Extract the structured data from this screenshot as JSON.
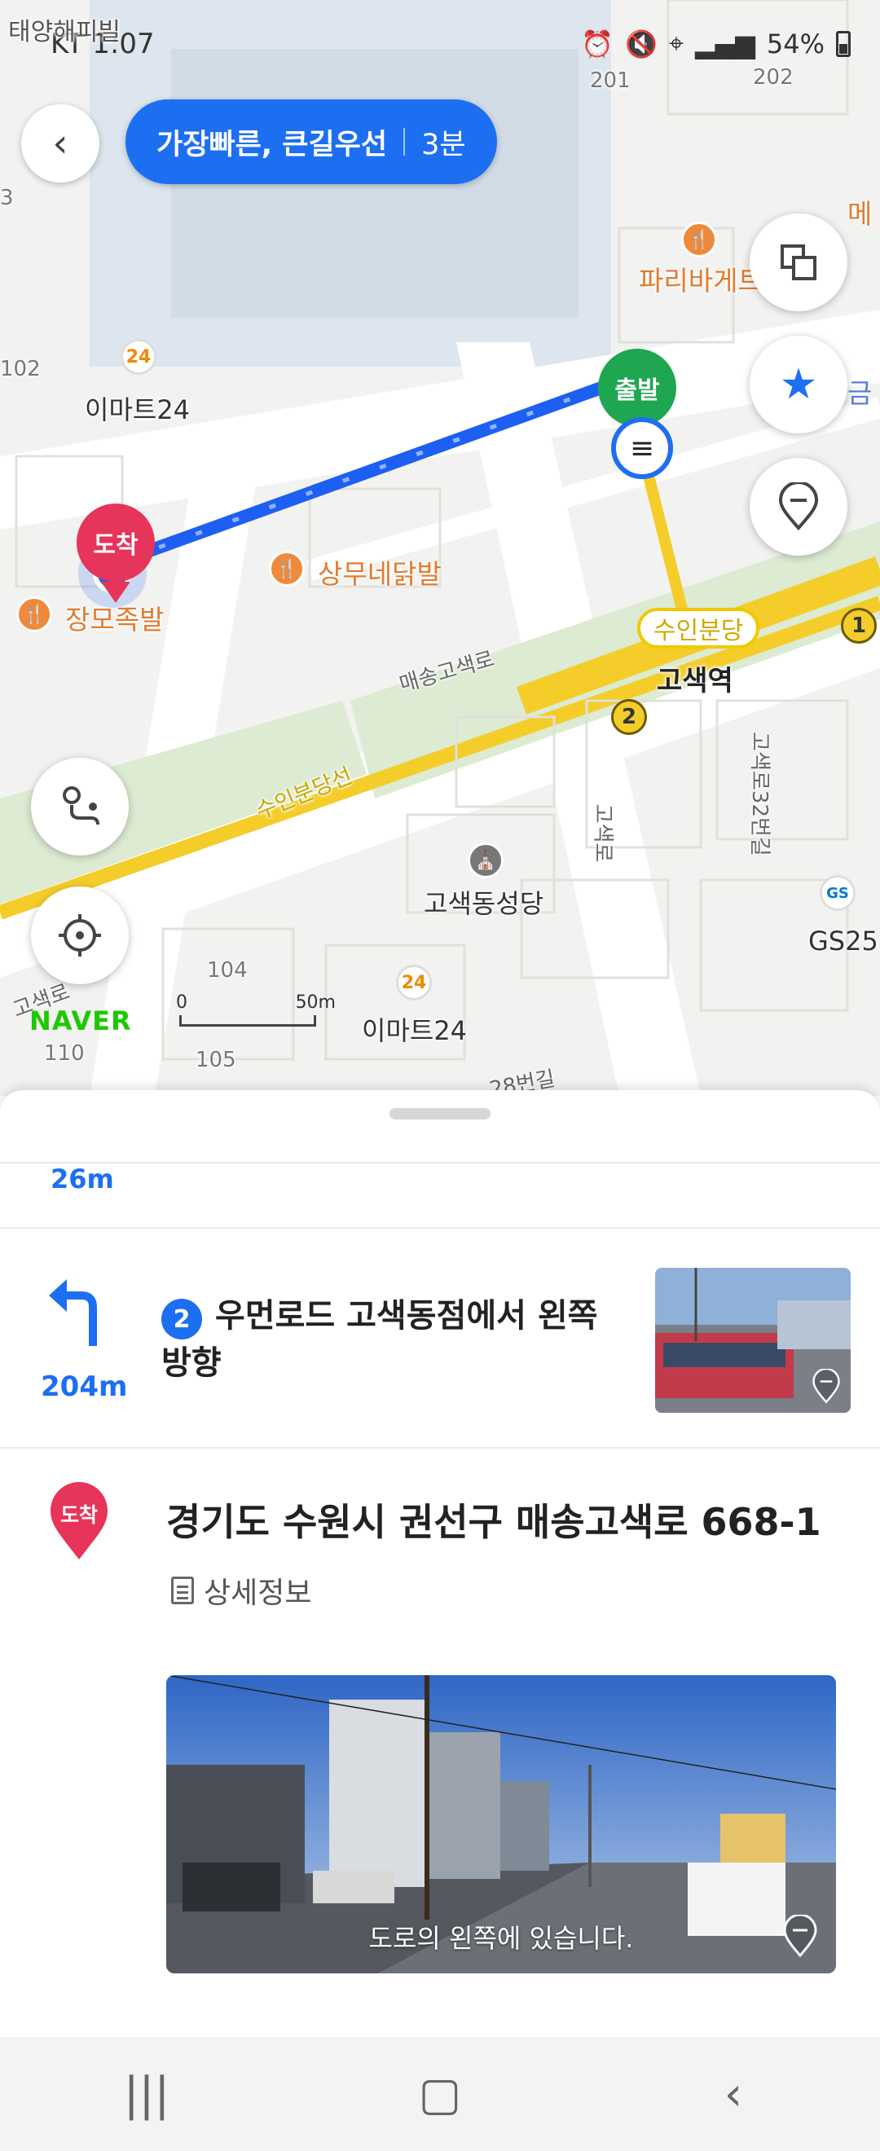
{
  "status_bar": {
    "carrier_time": "KT 1:07",
    "battery": "54%"
  },
  "header": {
    "back_icon": "chevron-left-icon",
    "route_option": "가장빠른, 큰길우선",
    "route_time": "3분"
  },
  "map": {
    "labels": {
      "taeyang": "태양해피빌",
      "emart1": "이마트24",
      "emart2": "이마트24",
      "paris": "파리바게트",
      "jangmo": "장모족발",
      "sangmu": "상무네닭발",
      "maesong_road": "매송고색로",
      "suin_line": "수인분당선",
      "station": "고색역",
      "station_badge": "수인분당",
      "church": "고색동성당",
      "gs25": "GS25",
      "gosaek_ro": "고색로",
      "gosaek_32": "고색로32번길",
      "road_28": "28번길",
      "gosaek_left": "고색로",
      "geum": "금",
      "me": "메",
      "num_201": "201",
      "num_202": "202",
      "num_102": "102",
      "num_104": "104",
      "num_105": "105",
      "num_110": "110",
      "num_3": "3"
    },
    "dest_pin_label": "도착",
    "start_pin_label": "출발",
    "line_num_1": "1",
    "line_num_2": "2",
    "logo": "NAVER",
    "scale_0": "0",
    "scale_50": "50m"
  },
  "sheet": {
    "prev_step_distance": "26m",
    "step": {
      "number": "2",
      "text": "우먼로드 고색동점에서 왼쪽 방향",
      "distance": "204m",
      "turn_icon": "turn-left-arrow-icon"
    },
    "destination": {
      "badge": "도착",
      "address": "경기도 수원시 권선구 매송고색로 668-1",
      "detail_label": "상세정보",
      "photo_caption": "도로의 왼쪽에 있습니다."
    }
  },
  "colors": {
    "accent_blue": "#1d6ff2",
    "dest_red": "#e6345a",
    "start_green": "#1fa651",
    "subway_yellow": "#f4cd2a",
    "naver_green": "#1ec800"
  }
}
